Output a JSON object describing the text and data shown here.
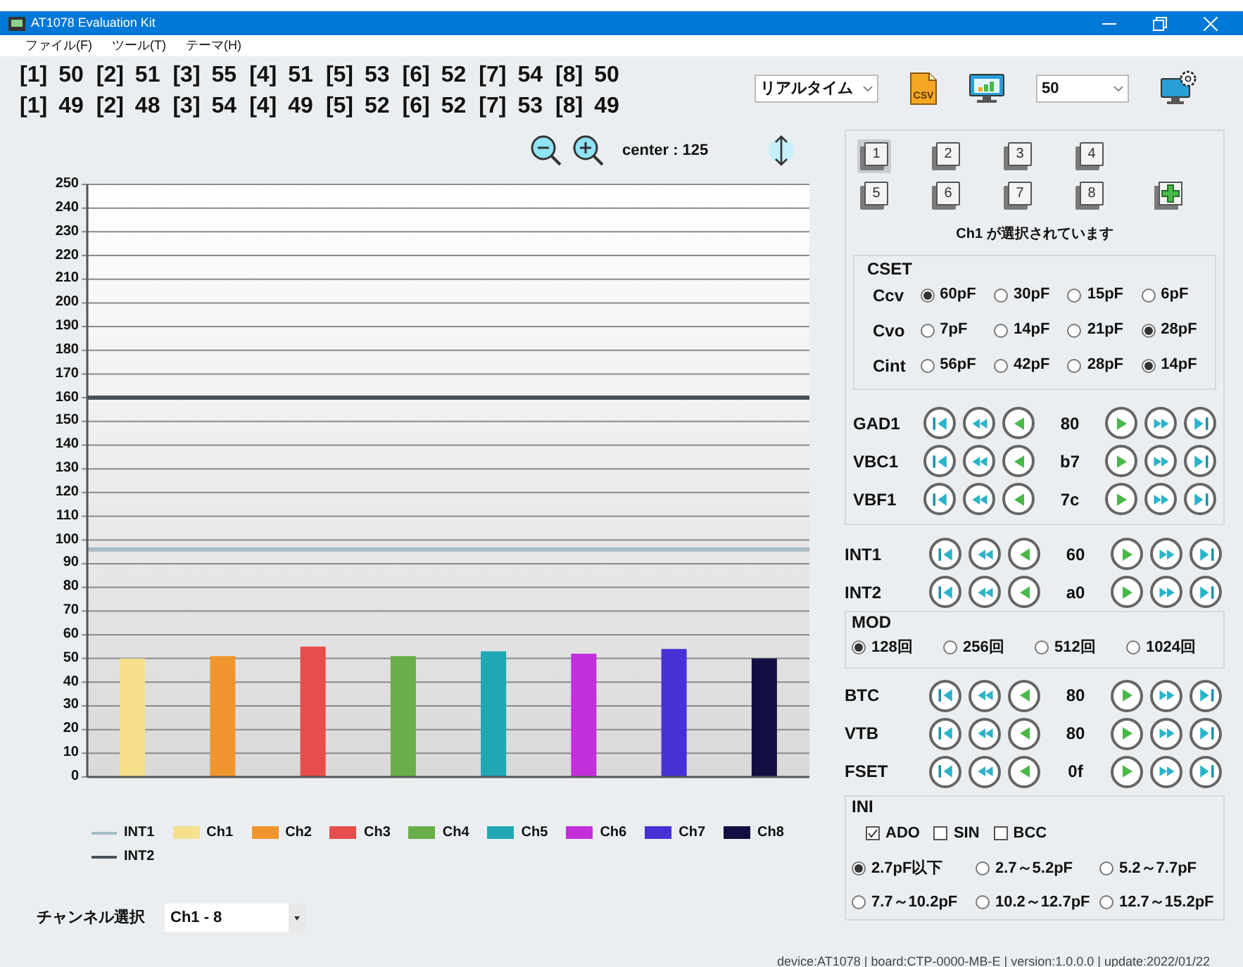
{
  "window": {
    "title": "AT1078 Evaluation Kit"
  },
  "menu": [
    "ファイル(F)",
    "ツール(T)",
    "テーマ(H)"
  ],
  "readouts": [
    [
      {
        "label": "[1]",
        "value": "50"
      },
      {
        "label": "[2]",
        "value": "51"
      },
      {
        "label": "[3]",
        "value": "55"
      },
      {
        "label": "[4]",
        "value": "51"
      },
      {
        "label": "[5]",
        "value": "53"
      },
      {
        "label": "[6]",
        "value": "52"
      },
      {
        "label": "[7]",
        "value": "54"
      },
      {
        "label": "[8]",
        "value": "50"
      }
    ],
    [
      {
        "label": "[1]",
        "value": "49"
      },
      {
        "label": "[2]",
        "value": "48"
      },
      {
        "label": "[3]",
        "value": "54"
      },
      {
        "label": "[4]",
        "value": "49"
      },
      {
        "label": "[5]",
        "value": "52"
      },
      {
        "label": "[6]",
        "value": "52"
      },
      {
        "label": "[7]",
        "value": "53"
      },
      {
        "label": "[8]",
        "value": "49"
      }
    ]
  ],
  "toolbar": {
    "mode": "リアルタイム",
    "csv_label": "CSV",
    "sample_count": "50"
  },
  "zoom": {
    "center": "center : 125"
  },
  "chart": {
    "chart_data": {
      "type": "bar",
      "ylim": [
        0,
        250
      ],
      "yticks": [
        0,
        10,
        20,
        30,
        40,
        50,
        60,
        70,
        80,
        90,
        100,
        110,
        120,
        130,
        140,
        150,
        160,
        170,
        180,
        190,
        200,
        210,
        220,
        230,
        240,
        250
      ],
      "series": [
        {
          "name": "Ch1",
          "color": "#f6e08e",
          "values": [
            50,
            null,
            null,
            null,
            null,
            null,
            null,
            null
          ]
        },
        {
          "name": "Ch2",
          "color": "#f0952e",
          "values": [
            null,
            51,
            null,
            null,
            null,
            null,
            null,
            null
          ]
        },
        {
          "name": "Ch3",
          "color": "#e84d4d",
          "values": [
            null,
            null,
            55,
            null,
            null,
            null,
            null,
            null
          ]
        },
        {
          "name": "Ch4",
          "color": "#6aae4b",
          "values": [
            null,
            null,
            null,
            51,
            null,
            null,
            null,
            null
          ]
        },
        {
          "name": "Ch5",
          "color": "#21a6b4",
          "values": [
            null,
            null,
            null,
            null,
            53,
            null,
            null,
            null
          ]
        },
        {
          "name": "Ch6",
          "color": "#c22fdb",
          "values": [
            null,
            null,
            null,
            null,
            null,
            52,
            null,
            null
          ]
        },
        {
          "name": "Ch7",
          "color": "#4632d4",
          "values": [
            null,
            null,
            null,
            null,
            null,
            null,
            54,
            null
          ]
        },
        {
          "name": "Ch8",
          "color": "#140f42",
          "values": [
            null,
            null,
            null,
            null,
            null,
            null,
            null,
            50
          ]
        }
      ],
      "grid": true,
      "ref_lines": [
        {
          "axis": "y",
          "value": 96,
          "label": "INT1",
          "color": "#a7bac8"
        },
        {
          "axis": "y",
          "value": 160,
          "label": "INT2",
          "color": "#48525c"
        }
      ]
    }
  },
  "channel_select": {
    "label": "チャンネル選択",
    "value": "Ch1 - 8"
  },
  "channel_buttons": [
    {
      "label": "1",
      "selected": true
    },
    {
      "label": "2",
      "selected": false
    },
    {
      "label": "3",
      "selected": false
    },
    {
      "label": "4",
      "selected": false
    },
    {
      "label": "5",
      "selected": false
    },
    {
      "label": "6",
      "selected": false
    },
    {
      "label": "7",
      "selected": false
    },
    {
      "label": "8",
      "selected": false
    }
  ],
  "status": "Ch1 が選択されています",
  "cset": {
    "title": "CSET",
    "rows": [
      {
        "label": "Ccv",
        "options": [
          {
            "label": "60pF",
            "selected": true
          },
          {
            "label": "30pF",
            "selected": false
          },
          {
            "label": "15pF",
            "selected": false
          },
          {
            "label": "6pF",
            "selected": false
          }
        ]
      },
      {
        "label": "Cvo",
        "options": [
          {
            "label": "7pF",
            "selected": false
          },
          {
            "label": "14pF",
            "selected": false
          },
          {
            "label": "21pF",
            "selected": false
          },
          {
            "label": "28pF",
            "selected": true
          }
        ]
      },
      {
        "label": "Cint",
        "options": [
          {
            "label": "56pF",
            "selected": false
          },
          {
            "label": "42pF",
            "selected": false
          },
          {
            "label": "28pF",
            "selected": false
          },
          {
            "label": "14pF",
            "selected": true
          }
        ]
      }
    ]
  },
  "registers_a": [
    {
      "label": "GAD1",
      "value": "80"
    },
    {
      "label": "VBC1",
      "value": "b7"
    },
    {
      "label": "VBF1",
      "value": "7c"
    }
  ],
  "registers_b": [
    {
      "label": "INT1",
      "value": "60"
    },
    {
      "label": "INT2",
      "value": "a0"
    }
  ],
  "mod": {
    "title": "MOD",
    "options": [
      {
        "label": "128回",
        "selected": true
      },
      {
        "label": "256回",
        "selected": false
      },
      {
        "label": "512回",
        "selected": false
      },
      {
        "label": "1024回",
        "selected": false
      }
    ]
  },
  "registers_c": [
    {
      "label": "BTC",
      "value": "80"
    },
    {
      "label": "VTB",
      "value": "80"
    },
    {
      "label": "FSET",
      "value": "0f"
    }
  ],
  "ini": {
    "title": "INI",
    "checks": [
      {
        "label": "ADO",
        "checked": true
      },
      {
        "label": "SIN",
        "checked": false
      },
      {
        "label": "BCC",
        "checked": false
      }
    ],
    "ranges": [
      {
        "label": "2.7pF以下",
        "selected": true
      },
      {
        "label": "2.7～5.2pF",
        "selected": false
      },
      {
        "label": "5.2～7.7pF",
        "selected": false
      },
      {
        "label": "7.7～10.2pF",
        "selected": false
      },
      {
        "label": "10.2～12.7pF",
        "selected": false
      },
      {
        "label": "12.7～15.2pF",
        "selected": false
      }
    ]
  },
  "footer": "device:AT1078 | board:CTP-0000-MB-E | version:1.0.0.0 | update:2022/01/22"
}
